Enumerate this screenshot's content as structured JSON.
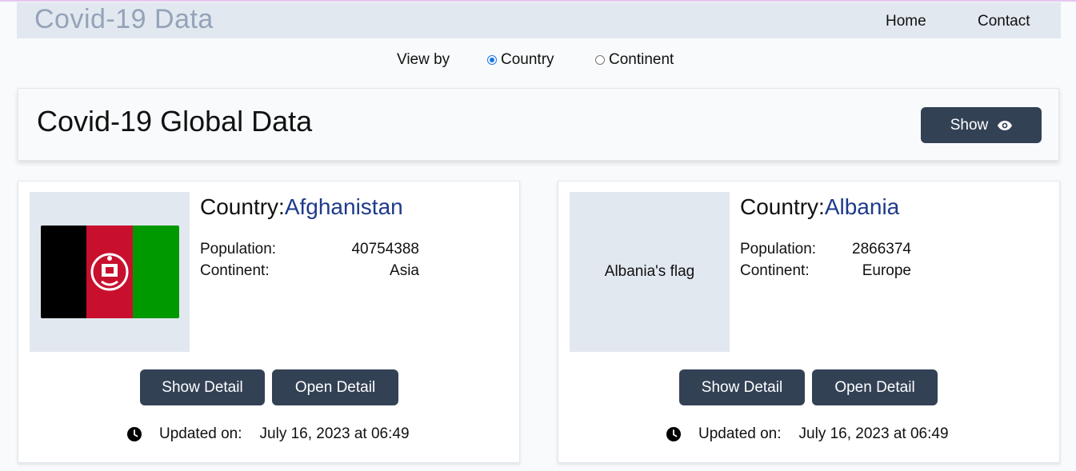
{
  "navbar": {
    "brand": "Covid-19 Data",
    "links": [
      "Home",
      "Contact"
    ]
  },
  "view_by": {
    "label": "View by",
    "options": [
      {
        "label": "Country",
        "checked": true
      },
      {
        "label": "Continent",
        "checked": false
      }
    ]
  },
  "global": {
    "title": "Covid-19 Global Data",
    "show_label": "Show",
    "show_icon": "eye-icon"
  },
  "cards": [
    {
      "country_prefix": "Country:",
      "country": "Afghanistan",
      "flag_alt": "",
      "flag_colors": [
        "#000000",
        "#c8102e",
        "#009900"
      ],
      "population_label": "Population:",
      "population": "40754388",
      "continent_label": "Continent:",
      "continent": "Asia",
      "show_detail": "Show Detail",
      "open_detail": "Open Detail",
      "updated_label": "Updated on:",
      "updated_value": "July 16, 2023 at 06:49"
    },
    {
      "country_prefix": "Country:",
      "country": "Albania",
      "flag_alt": "Albania's flag",
      "population_label": "Population:",
      "population": "2866374",
      "continent_label": "Continent:",
      "continent": "Europe",
      "show_detail": "Show Detail",
      "open_detail": "Open Detail",
      "updated_label": "Updated on:",
      "updated_value": "July 16, 2023 at 06:49"
    }
  ],
  "colors": {
    "navbar_bg": "#e2e8f0",
    "brand": "#94a3b8",
    "button_bg": "#334155",
    "country_name": "#1e3a8a",
    "radio_accent": "#1a73e8"
  }
}
